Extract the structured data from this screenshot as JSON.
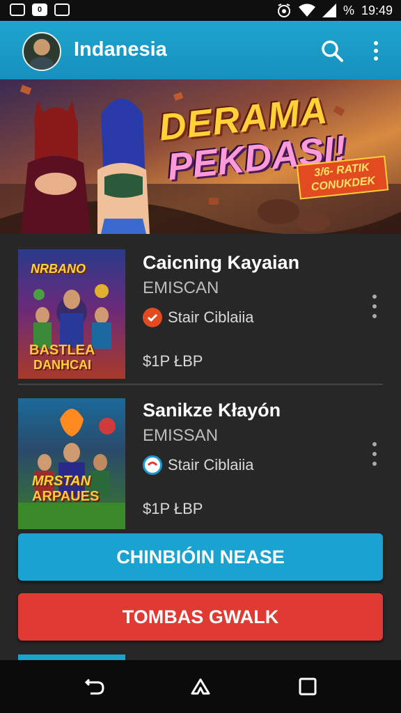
{
  "status_bar": {
    "left_icons": [
      "sim-icon",
      "notification-icon",
      "screenshot-icon"
    ],
    "left_box_texts": [
      "",
      "0",
      ""
    ],
    "alarm_icon": "alarm-icon",
    "wifi_icon": "wifi-icon",
    "signal_icon": "signal-icon",
    "battery_text": "%",
    "time": "19:49"
  },
  "app_bar": {
    "title": "Indanesia",
    "search_icon": "search-icon",
    "more_icon": "more-vert-icon"
  },
  "banner": {
    "title_line1": "DERAMA",
    "title_line2": "PEKDASI!",
    "badge_line1": "3/6- RATIK",
    "badge_line2": "CONUKDEK"
  },
  "items": [
    {
      "title": "Caicning Kayaian",
      "publisher": "EMISCAN",
      "rating_label": "Stair Ciblaiia",
      "price": "$1P ŁBP",
      "thumb_text1": "NRBANO",
      "thumb_text2": "BASTLEA",
      "thumb_text3": "DANHCAI",
      "badge_color": "#e24a20"
    },
    {
      "title": "Sanikze Kłayón",
      "publisher": "EMISSAN",
      "rating_label": "Stair Ciblaiia",
      "price": "$1P ŁBP",
      "thumb_text1": "MRSTAN",
      "thumb_text2": "ARPAUES",
      "badge_color": "#1a9ad0"
    }
  ],
  "buttons": {
    "primary": "CHINBIÓIN NEASE",
    "secondary": "TOMBAS GWALK"
  },
  "colors": {
    "appbar": "#1ea6cf",
    "primary_button": "#1aa3d0",
    "secondary_button": "#e13a33",
    "background": "#272727"
  },
  "nav_bar": {
    "back_icon": "back-icon",
    "home_icon": "home-icon",
    "recents_icon": "recents-icon"
  }
}
